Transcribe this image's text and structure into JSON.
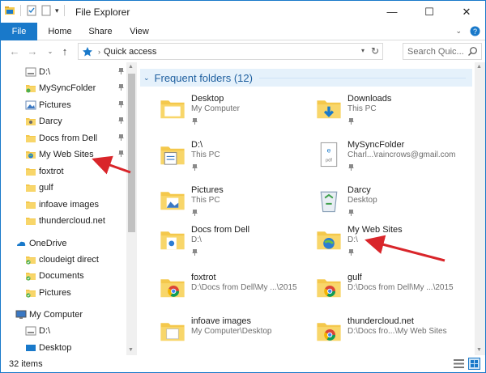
{
  "window": {
    "title": "File Explorer",
    "controls": {
      "minimize": "—",
      "maximize": "☐",
      "close": "✕"
    }
  },
  "ribbon": {
    "tabs": [
      "File",
      "Home",
      "Share",
      "View"
    ]
  },
  "address": {
    "breadcrumb": "Quick access",
    "search_placeholder": "Search Quic..."
  },
  "nav": {
    "items": [
      {
        "label": "D:\\",
        "icon": "drive-icon",
        "pinned": true
      },
      {
        "label": "MySyncFolder",
        "icon": "sync-folder-icon",
        "pinned": true
      },
      {
        "label": "Pictures",
        "icon": "pictures-icon",
        "pinned": true
      },
      {
        "label": "Darcy",
        "icon": "user-folder-icon",
        "pinned": true
      },
      {
        "label": "Docs from Dell",
        "icon": "folder-icon",
        "pinned": true
      },
      {
        "label": "My Web Sites",
        "icon": "web-folder-icon",
        "pinned": true
      },
      {
        "label": "foxtrot",
        "icon": "folder-icon",
        "pinned": false
      },
      {
        "label": "gulf",
        "icon": "folder-icon",
        "pinned": false
      },
      {
        "label": "infoave images",
        "icon": "folder-icon",
        "pinned": false
      },
      {
        "label": "thundercloud.net",
        "icon": "folder-icon",
        "pinned": false
      },
      {
        "label": "OneDrive",
        "icon": "onedrive-icon",
        "pinned": false
      },
      {
        "label": "cloudeigt direct",
        "icon": "synced-folder-icon",
        "pinned": false
      },
      {
        "label": "Documents",
        "icon": "synced-folder-icon",
        "pinned": false
      },
      {
        "label": "Pictures",
        "icon": "synced-folder-icon",
        "pinned": false
      },
      {
        "label": "My Computer",
        "icon": "computer-icon",
        "pinned": false
      },
      {
        "label": "D:\\",
        "icon": "drive-icon",
        "pinned": false
      },
      {
        "label": "Desktop",
        "icon": "desktop-icon",
        "pinned": false
      }
    ]
  },
  "content": {
    "group_title": "Frequent folders (12)",
    "folders": [
      {
        "name": "Desktop",
        "location": "My Computer",
        "icon": "desktop-folder-icon",
        "pinned": true
      },
      {
        "name": "Downloads",
        "location": "This PC",
        "icon": "downloads-folder-icon",
        "pinned": true
      },
      {
        "name": "D:\\",
        "location": "This PC",
        "icon": "drive-folder-icon",
        "pinned": true
      },
      {
        "name": "MySyncFolder",
        "location": "Charl...\\raincrows@gmail.com",
        "icon": "pdf-folder-icon",
        "pinned": true
      },
      {
        "name": "Pictures",
        "location": "This PC",
        "icon": "pictures-folder-icon",
        "pinned": true
      },
      {
        "name": "Darcy",
        "location": "Desktop",
        "icon": "recycle-icon",
        "pinned": true
      },
      {
        "name": "Docs from Dell",
        "location": "D:\\",
        "icon": "docs-folder-icon",
        "pinned": true
      },
      {
        "name": "My Web Sites",
        "location": "D:\\",
        "icon": "web-folder-icon",
        "pinned": true
      },
      {
        "name": "foxtrot",
        "location": "D:\\Docs from Dell\\My ...\\2015",
        "icon": "chrome-folder-icon",
        "pinned": false
      },
      {
        "name": "gulf",
        "location": "D:\\Docs from Dell\\My ...\\2015",
        "icon": "chrome-folder-icon",
        "pinned": false
      },
      {
        "name": "infoave images",
        "location": "My Computer\\Desktop",
        "icon": "images-folder-icon",
        "pinned": false
      },
      {
        "name": "thundercloud.net",
        "location": "D:\\Docs fro...\\My Web Sites",
        "icon": "chrome-folder-icon",
        "pinned": false
      }
    ]
  },
  "status": {
    "item_count": "32 items"
  },
  "colors": {
    "accent": "#1979ca",
    "folder": "#f4c84c",
    "annotation_arrow": "#d9252a"
  }
}
